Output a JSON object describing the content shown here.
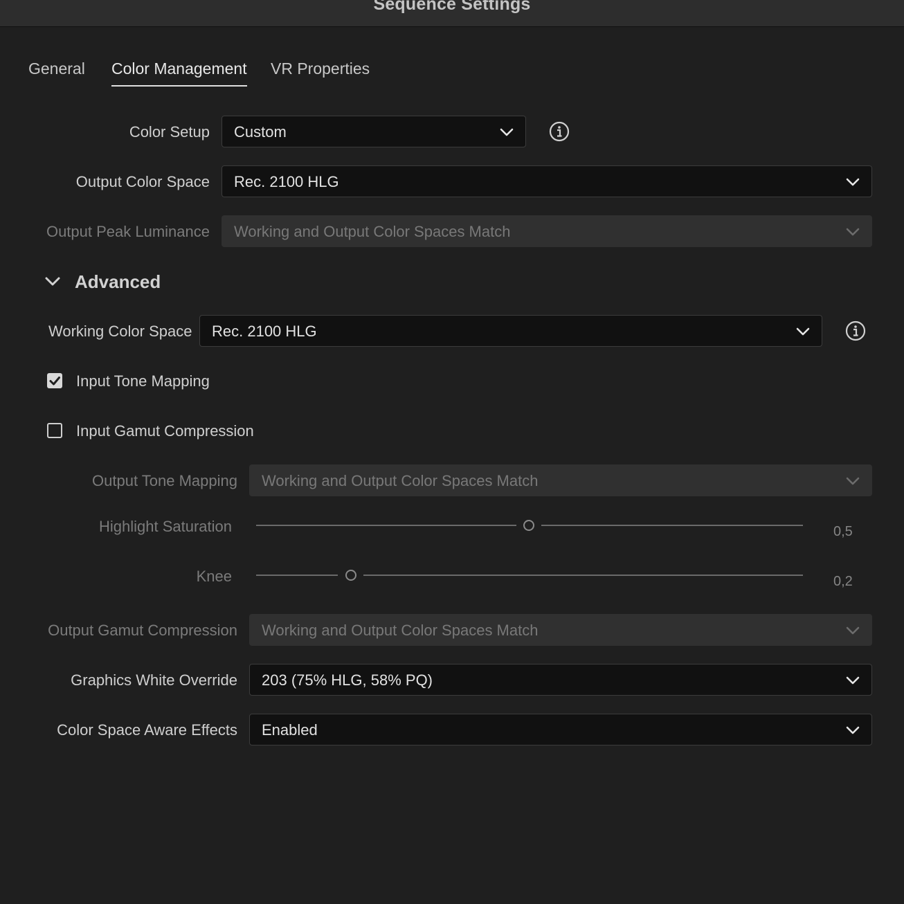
{
  "window": {
    "title": "Sequence Settings"
  },
  "tabs": [
    {
      "label": "General",
      "active": false
    },
    {
      "label": "Color Management",
      "active": true
    },
    {
      "label": "VR Properties",
      "active": false
    }
  ],
  "color_setup": {
    "label": "Color Setup",
    "value": "Custom",
    "info_icon": "info-icon"
  },
  "output_color_space": {
    "label": "Output Color Space",
    "value": "Rec. 2100 HLG"
  },
  "output_peak_luminance": {
    "label": "Output Peak Luminance",
    "value": "Working and Output Color Spaces Match",
    "disabled": true
  },
  "advanced": {
    "title": "Advanced",
    "expanded": true,
    "toggle_icon": "chevron-down-icon"
  },
  "working_color_space": {
    "label": "Working Color Space",
    "value": "Rec. 2100 HLG",
    "info_icon": "info-icon"
  },
  "input_tone_mapping": {
    "label": "Input Tone Mapping",
    "checked": true
  },
  "input_gamut_compression": {
    "label": "Input Gamut Compression",
    "checked": false
  },
  "output_tone_mapping": {
    "label": "Output Tone Mapping",
    "value": "Working and Output Color Spaces Match",
    "disabled": true
  },
  "highlight_saturation": {
    "label": "Highlight Saturation",
    "value_text": "0,5",
    "value": 0.5,
    "disabled": true
  },
  "knee": {
    "label": "Knee",
    "value_text": "0,2",
    "value": 0.2,
    "disabled": true
  },
  "output_gamut_compression": {
    "label": "Output Gamut Compression",
    "value": "Working and Output Color Spaces Match",
    "disabled": true
  },
  "graphics_white_override": {
    "label": "Graphics White Override",
    "value": "203 (75% HLG, 58% PQ)"
  },
  "color_space_aware_effects": {
    "label": "Color Space Aware Effects",
    "value": "Enabled"
  },
  "colors": {
    "background": "#1f1f1f",
    "field": "#111111",
    "field_disabled": "#303030",
    "text": "#d6d6d6",
    "text_dim": "#7b7b7b"
  }
}
